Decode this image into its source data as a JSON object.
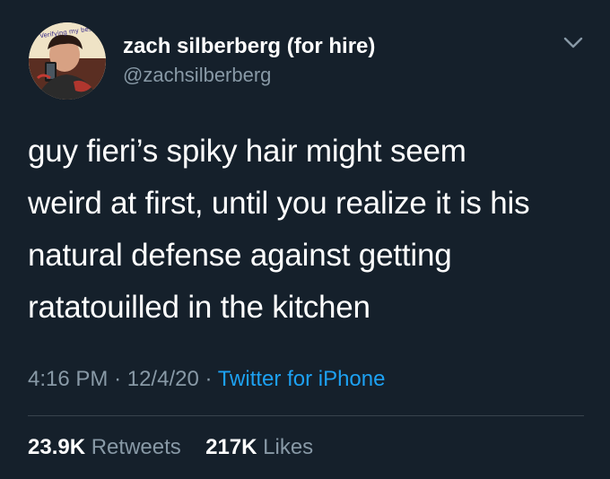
{
  "author": {
    "display_name": "zach silberberg (for hire)",
    "handle": "@zachsilberberg",
    "avatar_caption": "Verifying my best"
  },
  "tweet": {
    "text_lines": [
      "guy fieri’s spiky hair might seem",
      "weird at first, until you realize it is his",
      "natural defense against getting",
      "ratatouilled in the kitchen"
    ]
  },
  "meta": {
    "time": "4:16 PM",
    "separator": "·",
    "date": "12/4/20",
    "source": "Twitter for iPhone"
  },
  "stats": {
    "retweets_count": "23.9K",
    "retweets_label": "Retweets",
    "likes_count": "217K",
    "likes_label": "Likes"
  },
  "icons": {
    "more_menu": "chevron-down-icon"
  },
  "colors": {
    "background": "#15202b",
    "secondary_text": "#8899a6",
    "link": "#1da1f2",
    "divider": "#38444d"
  }
}
